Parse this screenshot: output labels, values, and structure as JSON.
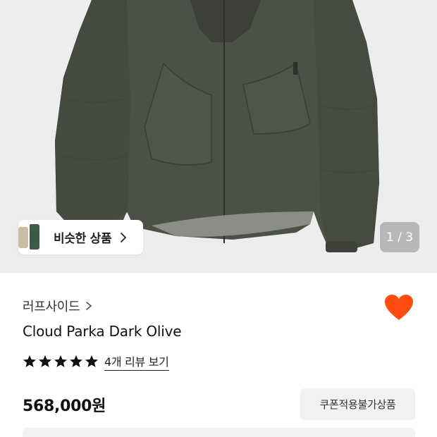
{
  "product_image": {
    "similar_products_label": "비슷한 상품",
    "pager": "1 / 3"
  },
  "product": {
    "brand": "러프사이드",
    "title": "Cloud Parka Dark Olive",
    "rating_stars": 5,
    "review_link": "4개 리뷰 보기",
    "price": "568,000원",
    "coupon_label": "쿠폰적용불가상품",
    "wishlisted": true
  },
  "colors": {
    "heart": "#ff4d12",
    "jacket": "#4a4f46",
    "image_bg": "#ededed"
  },
  "icons": {
    "similar_arrow": "chevron-right-icon",
    "brand_arrow": "chevron-right-icon",
    "wishlist": "heart-icon",
    "rating": "star-icon"
  }
}
